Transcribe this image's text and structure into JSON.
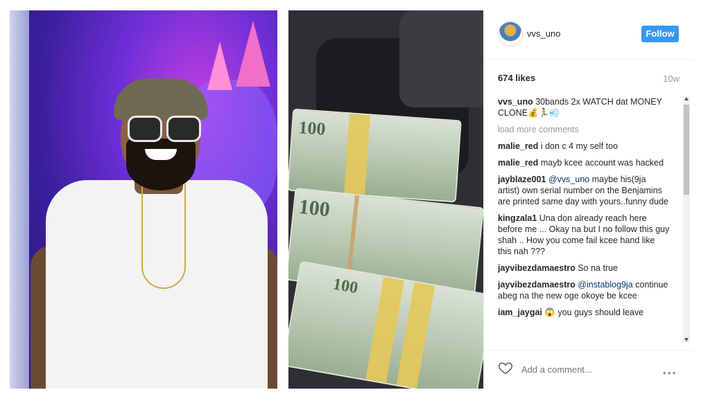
{
  "post": {
    "header": {
      "username": "vvs_uno",
      "follow_label": "Follow"
    },
    "likes": "674 likes",
    "age": "10w",
    "caption": {
      "user": "vvs_uno",
      "text": "30bands 2x WATCH dat MONEY CLONE💰🏃💨"
    },
    "load_more": "load more comments",
    "comments": [
      {
        "user": "malie_red",
        "text": "i don c 4 my self too"
      },
      {
        "user": "malie_red",
        "text": "mayb kcee account was hacked"
      },
      {
        "user": "jayblaze001",
        "mention": "@vvs_uno",
        "text": "maybe his(9ja artist) own serial number on the Benjamins are printed same day with yours..funny dude"
      },
      {
        "user": "kingzala1",
        "text": "Una don already reach here before me ... Okay na but I no follow this guy shah .. How you come fail kcee hand like this nah ???"
      },
      {
        "user": "jayvibezdamaestro",
        "text": "So na true"
      },
      {
        "user": "jayvibezdamaestro",
        "mention": "@instablog9ja",
        "text": "continue abeg na the new oge okoye be kcee"
      },
      {
        "user": "iam_jaygai",
        "text": "😱 you guys should leave"
      }
    ],
    "add_comment_placeholder": "Add a comment...",
    "more_label": "•••"
  },
  "money": {
    "bill_labels": [
      "100",
      "100",
      "100"
    ],
    "colors": {
      "band": "#e5c85a",
      "bill": "#b7c7b0"
    }
  },
  "colors": {
    "accent": "#3897f0",
    "text": "#262626",
    "muted": "#999999",
    "mention": "#003569"
  }
}
